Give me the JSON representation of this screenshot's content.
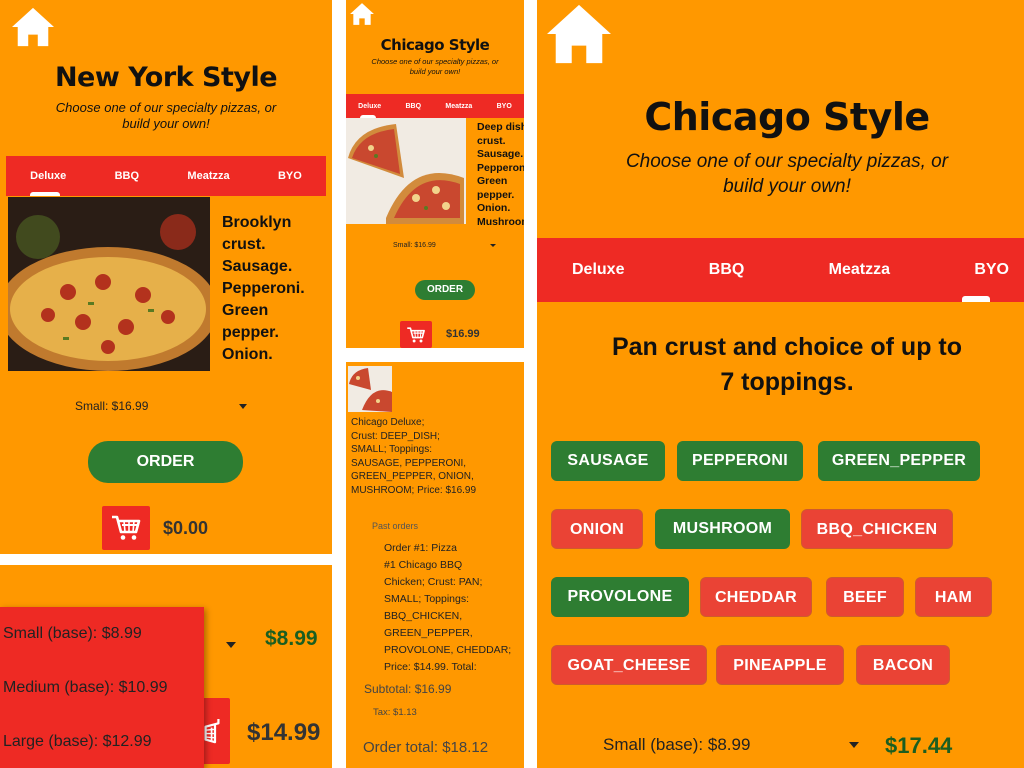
{
  "colors": {
    "background": "#FF9800",
    "tab_bar": "#EE2A24",
    "selected_chip": "#2E7D32",
    "unselected_chip": "#EA4335",
    "price_green": "#1B5E20"
  },
  "panel_ny": {
    "title": "New York Style",
    "subtitle_line1": "Choose one of our specialty pizzas, or",
    "subtitle_line2": "build your own!",
    "tabs": [
      "Deluxe",
      "BBQ",
      "Meatzza",
      "BYO"
    ],
    "description_lines": [
      "Brooklyn",
      "crust.",
      "Sausage.",
      "Pepperoni.",
      "Green",
      "pepper.",
      "Onion."
    ],
    "size_selected": "Small: $16.99",
    "order_label": "ORDER",
    "cart_total": "$0.00"
  },
  "panel_dropdown": {
    "options": [
      "Small (base): $8.99",
      "Medium (base): $10.99",
      "Large (base): $12.99"
    ],
    "price_top": "$8.99",
    "price_bottom": "$14.99"
  },
  "panel_chicago_small": {
    "title": "Chicago Style",
    "subtitle_line1": "Choose one of our specialty pizzas, or",
    "subtitle_line2": "build your own!",
    "tabs": [
      "Deluxe",
      "BBQ",
      "Meatzza",
      "BYO"
    ],
    "description_lines": [
      "Deep dish",
      "crust.",
      "Sausage.",
      "Pepperoni.",
      "Green",
      "pepper.",
      "Onion.",
      "Mushroom"
    ],
    "size_selected": "Small: $16.99",
    "order_label": "ORDER",
    "cart_total": "$16.99"
  },
  "panel_cart": {
    "item_lines": [
      "Chicago Deluxe;",
      "Crust: DEEP_DISH;",
      "SMALL; Toppings:",
      "SAUSAGE, PEPPERONI,",
      "GREEN_PEPPER, ONION,",
      "MUSHROOM; Price: $16.99"
    ],
    "past_orders_label": "Past orders",
    "past_order_lines": [
      "Order #1: Pizza",
      "#1 Chicago BBQ",
      "Chicken; Crust: PAN;",
      "SMALL; Toppings:",
      "BBQ_CHICKEN,",
      "GREEN_PEPPER,",
      "PROVOLONE, CHEDDAR;",
      "Price: $14.99. Total:"
    ],
    "subtotal": "Subtotal: $16.99",
    "tax": "Tax: $1.13",
    "order_total": "Order total: $18.12"
  },
  "panel_chicago_large": {
    "title": "Chicago Style",
    "subtitle_line1": "Choose one of our specialty pizzas, or",
    "subtitle_line2": "build your own!",
    "tabs": [
      "Deluxe",
      "BBQ",
      "Meatzza",
      "BYO"
    ],
    "description_line1": "Pan crust and choice of up to",
    "description_line2": "7 toppings.",
    "toppings": [
      {
        "label": "SAUSAGE",
        "selected": true
      },
      {
        "label": "PEPPERONI",
        "selected": true
      },
      {
        "label": "GREEN_PEPPER",
        "selected": true
      },
      {
        "label": "ONION",
        "selected": false
      },
      {
        "label": "MUSHROOM",
        "selected": true
      },
      {
        "label": "BBQ_CHICKEN",
        "selected": false
      },
      {
        "label": "PROVOLONE",
        "selected": true
      },
      {
        "label": "CHEDDAR",
        "selected": false
      },
      {
        "label": "BEEF",
        "selected": false
      },
      {
        "label": "HAM",
        "selected": false
      },
      {
        "label": "GOAT_CHEESE",
        "selected": false
      },
      {
        "label": "PINEAPPLE",
        "selected": false
      },
      {
        "label": "BACON",
        "selected": false
      }
    ],
    "size_selected": "Small (base): $8.99",
    "price": "$17.44"
  }
}
